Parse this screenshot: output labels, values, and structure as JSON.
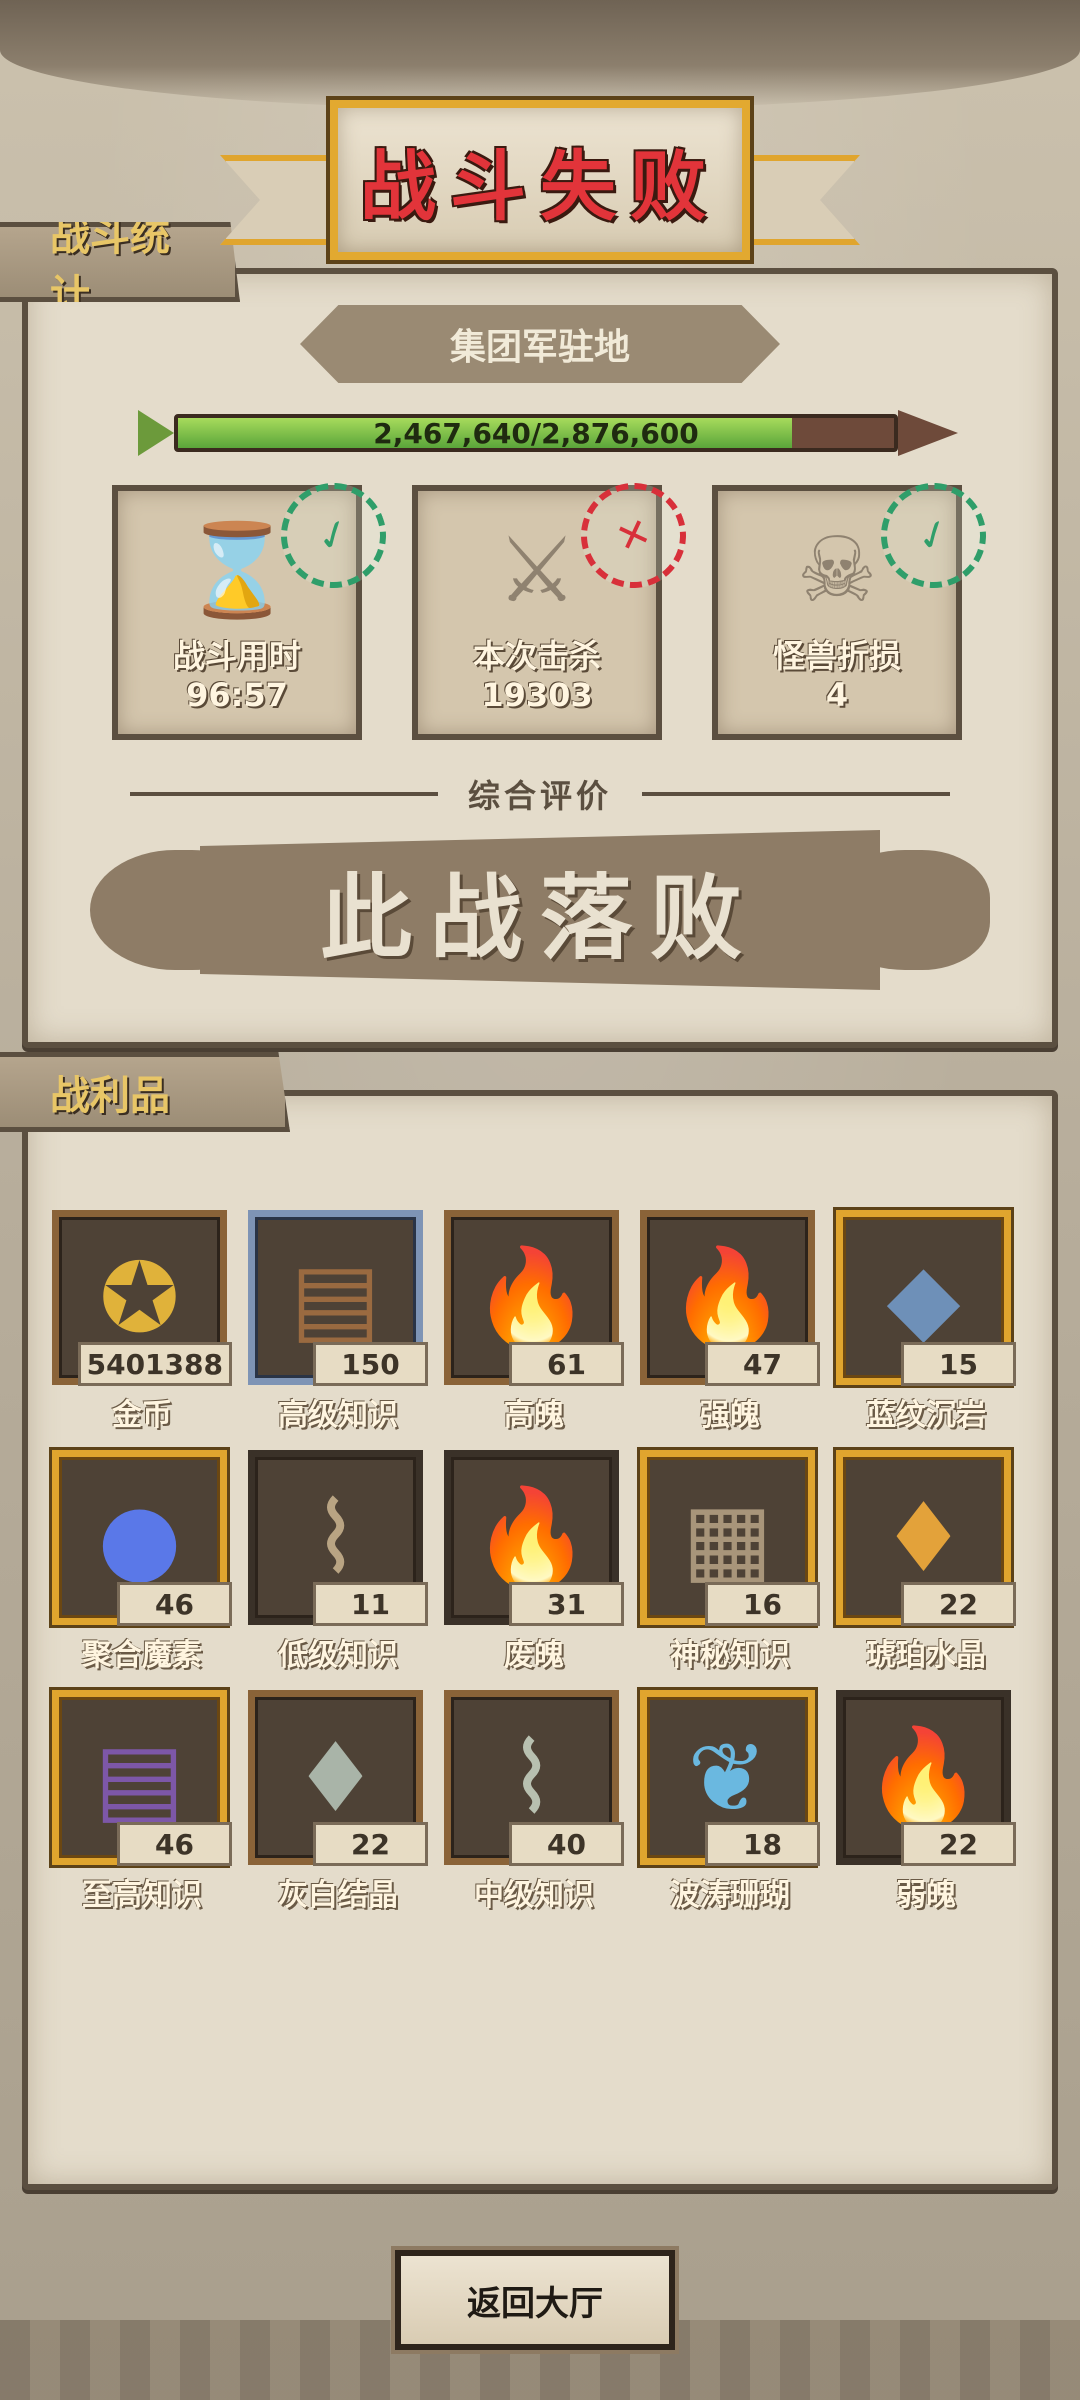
{
  "header": {
    "title": "战斗失败",
    "stats_tab": "战斗统计",
    "location": "集团军驻地"
  },
  "progress": {
    "text": "2,467,640/2,876,600",
    "current": 2467640,
    "max": 2876600
  },
  "stat_cards": [
    {
      "icon": "hourglass-icon",
      "label": "战斗用时",
      "value": "96:57",
      "stamp_color": "#2f9e6a"
    },
    {
      "icon": "crossed-swords-icon",
      "label": "本次击杀",
      "value": "19303",
      "stamp_color": "#d8303a"
    },
    {
      "icon": "skull-icon",
      "label": "怪兽折损",
      "value": "4",
      "stamp_color": "#2f9e6a"
    }
  ],
  "rating": {
    "label": "综合评价",
    "verdict": "此战落败"
  },
  "loot": {
    "title": "战利品",
    "items": [
      {
        "name": "金币",
        "count": "5401388",
        "frame": "plain",
        "icon": "gold-coin-icon",
        "color": "#e0b23a"
      },
      {
        "name": "高级知识",
        "count": "150",
        "frame": "blue",
        "icon": "book-icon",
        "color": "#9a6a40"
      },
      {
        "name": "高魄",
        "count": "61",
        "frame": "plain",
        "icon": "flame-icon",
        "color": "#f08a2a"
      },
      {
        "name": "强魄",
        "count": "47",
        "frame": "plain",
        "icon": "flame-icon",
        "color": "#f2b25a"
      },
      {
        "name": "蓝纹沉岩",
        "count": "15",
        "frame": "gold",
        "icon": "blue-rock-icon",
        "color": "#6e90b8"
      },
      {
        "name": "聚合魔素",
        "count": "46",
        "frame": "gold",
        "icon": "mana-orb-icon",
        "color": "#5a78e8"
      },
      {
        "name": "低级知识",
        "count": "11",
        "frame": "dark",
        "icon": "scroll-icon",
        "color": "#b9a483"
      },
      {
        "name": "废魄",
        "count": "31",
        "frame": "dark",
        "icon": "flame-icon",
        "color": "#e8a060"
      },
      {
        "name": "神秘知识",
        "count": "16",
        "frame": "gold",
        "icon": "stone-tablet-icon",
        "color": "#a8957a"
      },
      {
        "name": "琥珀水晶",
        "count": "22",
        "frame": "gold",
        "icon": "crystal-icon",
        "color": "#e3a23a"
      },
      {
        "name": "至高知识",
        "count": "46",
        "frame": "gold",
        "icon": "book-icon",
        "color": "#7d57a8"
      },
      {
        "name": "灰白结晶",
        "count": "22",
        "frame": "plain",
        "icon": "crystal-icon",
        "color": "#a9b4a8"
      },
      {
        "name": "中级知识",
        "count": "40",
        "frame": "plain",
        "icon": "scroll-icon",
        "color": "#b8c0b0"
      },
      {
        "name": "波涛珊瑚",
        "count": "18",
        "frame": "gold",
        "icon": "coral-icon",
        "color": "#6ab8e0"
      },
      {
        "name": "弱魄",
        "count": "22",
        "frame": "dark",
        "icon": "flame-icon",
        "color": "#e8a070"
      }
    ]
  },
  "footer": {
    "back_button": "返回大厅"
  }
}
